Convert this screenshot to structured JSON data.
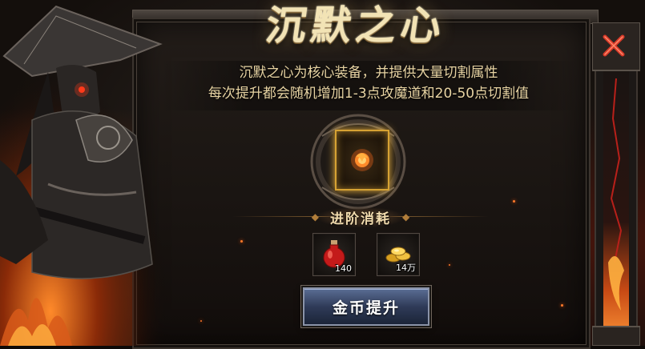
{
  "title": "沉默之心",
  "description": {
    "line1": "沉默之心为核心装备，并提供大量切割属性",
    "line2": "每次提升都会随机增加1-3点攻魔道和20-50点切割值"
  },
  "equipment_slot": {
    "icon": "flame-orb-icon"
  },
  "cost": {
    "header": "进阶消耗",
    "items": [
      {
        "icon": "red-potion-icon",
        "quantity": "140"
      },
      {
        "icon": "gold-coins-icon",
        "quantity": "14万"
      }
    ]
  },
  "upgrade_button": {
    "label": "金币提升"
  },
  "close_button": {
    "icon": "close-icon"
  },
  "colors": {
    "title": "#f2e3b5",
    "text": "#e8d4a3",
    "slot_border": "#d6a233",
    "button": "#3b4a6e",
    "close": "#d83a2a"
  }
}
